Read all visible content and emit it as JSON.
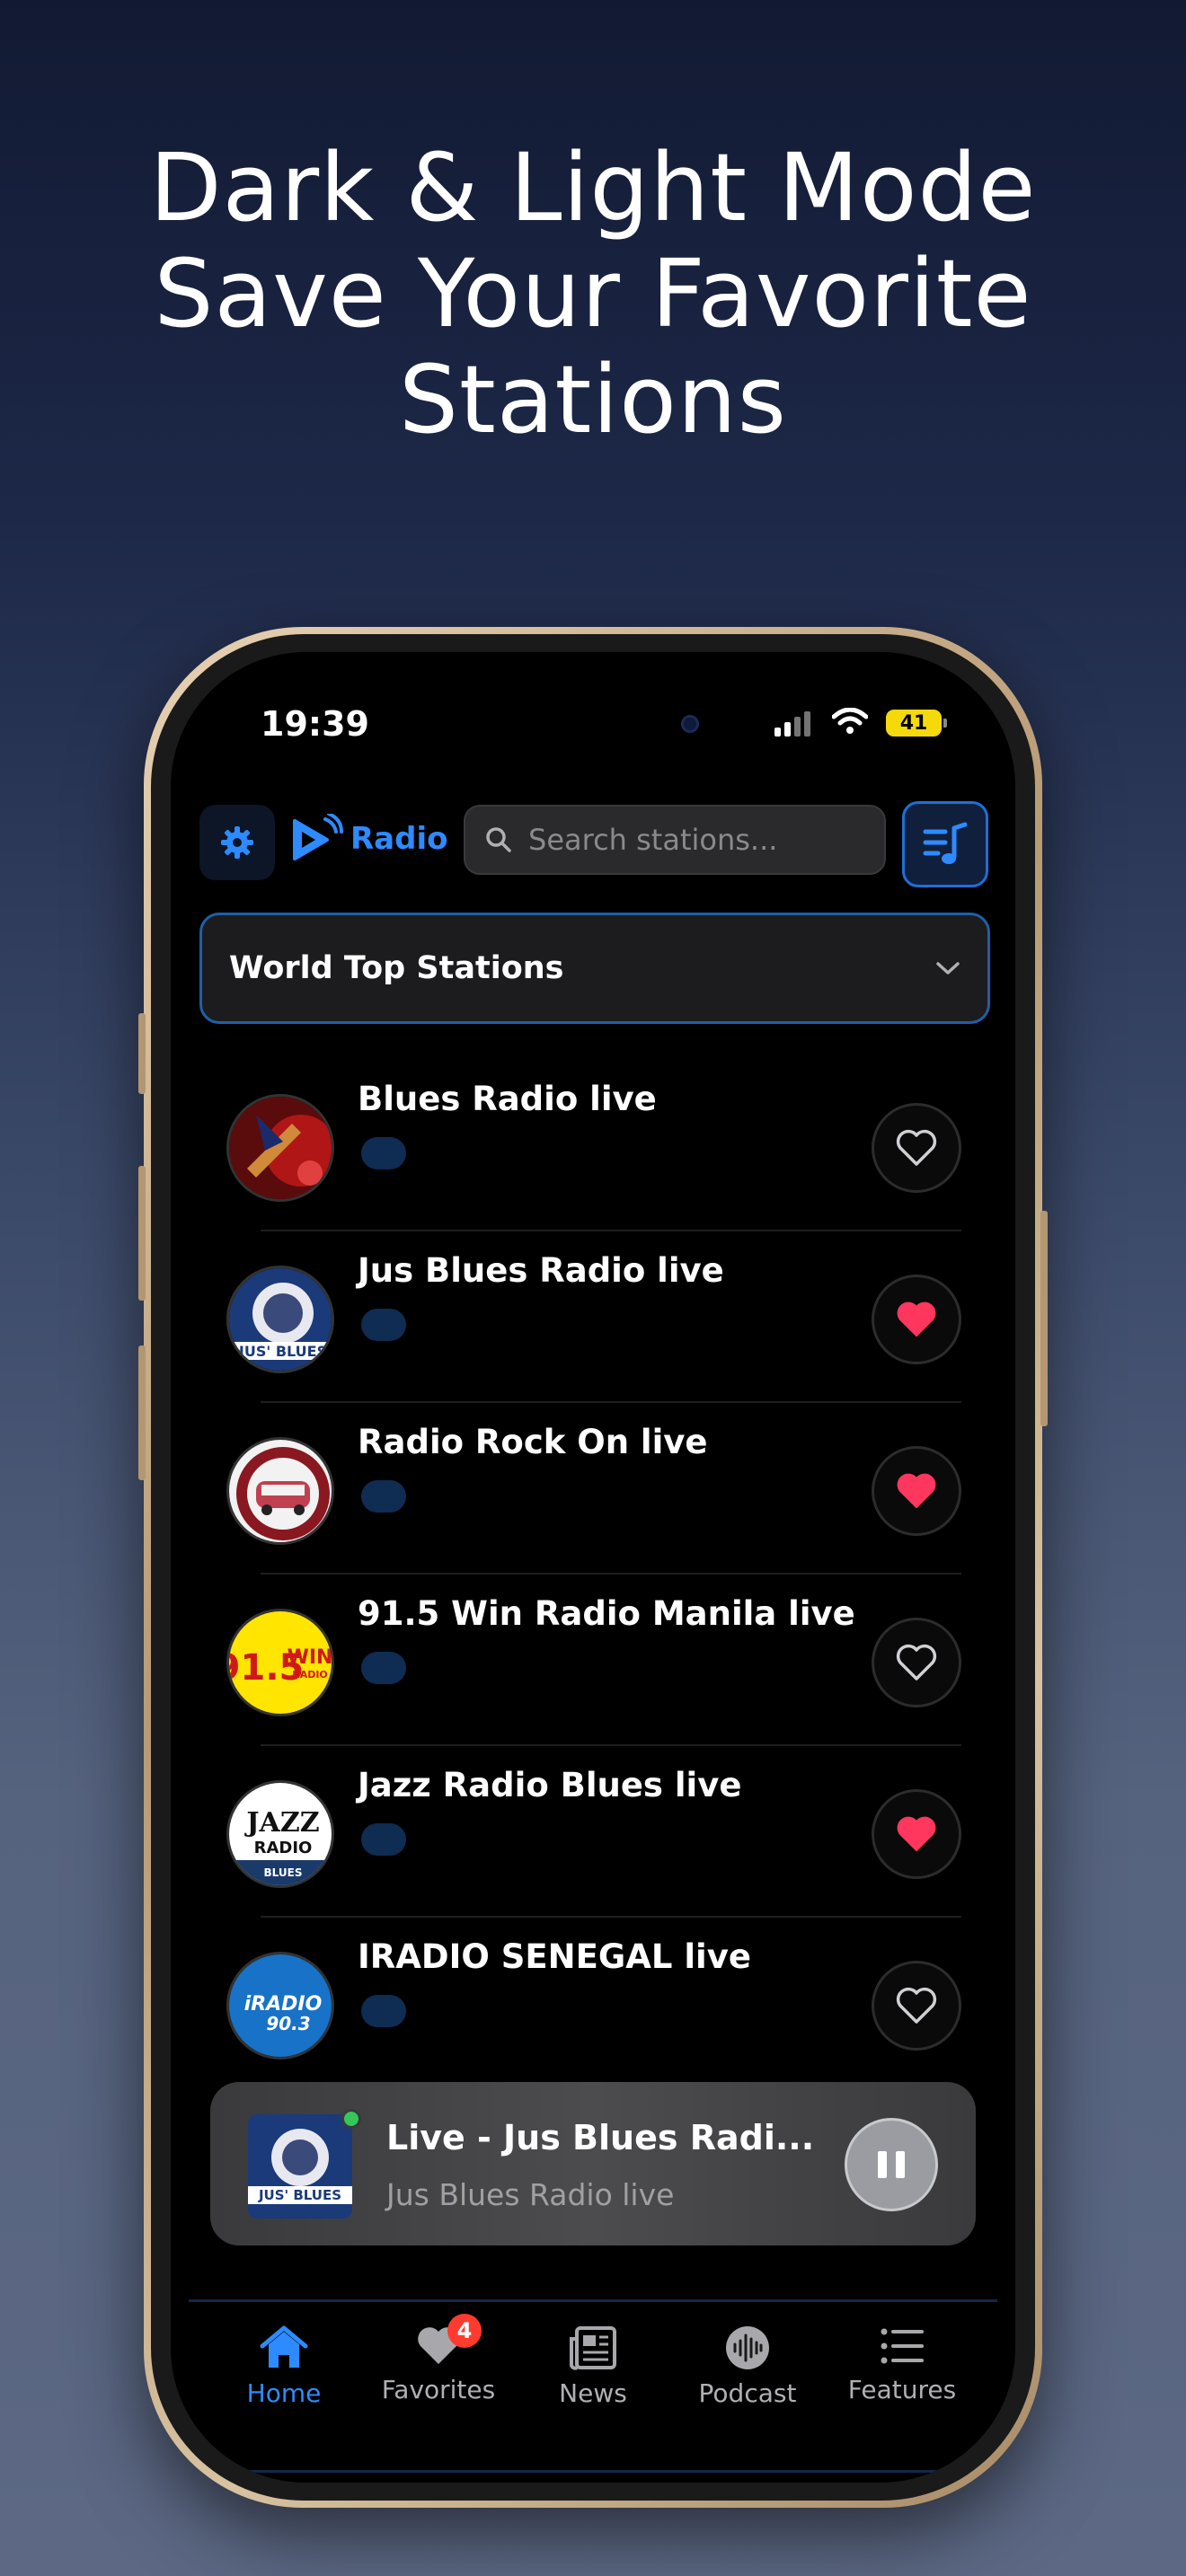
{
  "headline": {
    "line1": "Dark & Light Mode",
    "line2": "Save Your Favorite",
    "line3": "Stations"
  },
  "status_bar": {
    "time": "19:39",
    "battery": "41"
  },
  "header": {
    "logo_text": "Radio",
    "search_placeholder": "Search stations..."
  },
  "category": {
    "selected": "World Top Stations"
  },
  "stations": [
    {
      "name": "Blues Radio live",
      "favorite": false
    },
    {
      "name": "Jus Blues Radio live",
      "favorite": true
    },
    {
      "name": "Radio Rock On live",
      "favorite": true
    },
    {
      "name": "91.5 Win Radio Manila live",
      "favorite": false
    },
    {
      "name": "Jazz Radio Blues live",
      "favorite": true
    },
    {
      "name": "IRADIO SENEGAL live",
      "favorite": false
    }
  ],
  "now_playing": {
    "title": "Live - Jus Blues Radi...",
    "subtitle": "Jus Blues Radio live"
  },
  "tabs": [
    {
      "label": "Home",
      "icon": "home-icon",
      "active": true
    },
    {
      "label": "Favorites",
      "icon": "heart-icon",
      "badge": "4"
    },
    {
      "label": "News",
      "icon": "newspaper-icon"
    },
    {
      "label": "Podcast",
      "icon": "podcast-icon"
    },
    {
      "label": "Features",
      "icon": "list-icon"
    }
  ],
  "colors": {
    "accent": "#2e8bff",
    "favorite": "#ff375f",
    "live": "#34c759",
    "badge": "#ff3b30"
  }
}
